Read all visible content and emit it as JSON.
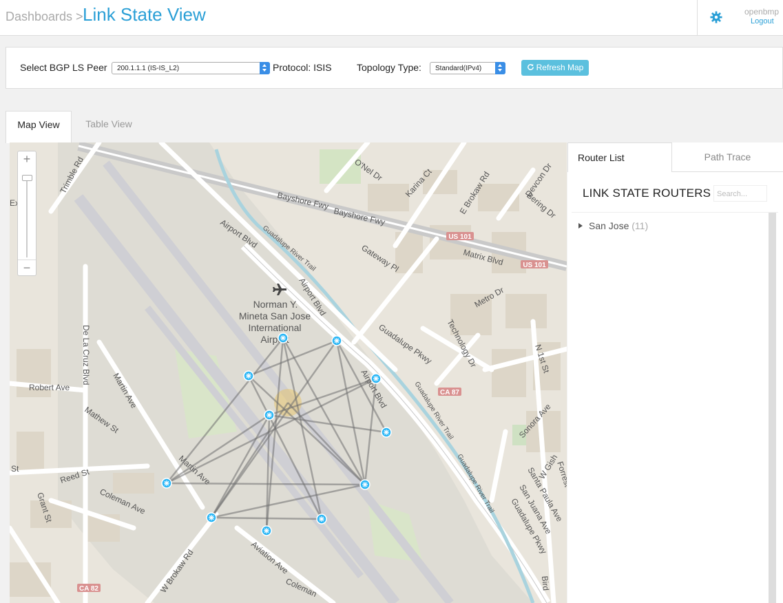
{
  "header": {
    "breadcrumb": "Dashboards >",
    "title": "Link State View",
    "username": "openbmp",
    "logout": "Logout"
  },
  "controls": {
    "peer_label": "Select BGP LS Peer",
    "peer_value": "200.1.1.1 (IS-IS_L2)",
    "protocol_label": "Protocol: ISIS",
    "topology_label": "Topology Type:",
    "topology_value": "Standard(IPv4)",
    "refresh_label": "Refresh Map"
  },
  "tabs": {
    "map": "Map View",
    "table": "Table View"
  },
  "map": {
    "zoom_in": "+",
    "zoom_out": "−",
    "airport_name": [
      "Norman Y.",
      "Mineta San Jose",
      "International",
      "Airport"
    ],
    "streets": [
      "Trimble Rd",
      "Bayshore Fwy",
      "Bayshore Fwy",
      "O'Nel Dr",
      "Karina Ct",
      "E Brokaw Rd",
      "Devcon Dr",
      "Bering Dr",
      "Airport Blvd",
      "Guadalupe River Trail",
      "Gateway Pl",
      "Matrix Blvd",
      "Airport Blvd",
      "Metro Dr",
      "Technology Dr",
      "Guadalupe Pkwy",
      "N 1st St",
      "De La Cruz Blvd",
      "Robert Ave",
      "Martin Ave",
      "Mathew St",
      "Airport Blvd",
      "Guadalupe River Trail",
      "Reed St",
      "Martin Ave",
      "Coleman Ave",
      "Grant St",
      "W Brokaw Rd",
      "Aviation Ave",
      "Coleman",
      "Sonora Ave",
      "W Gish",
      "Forrest",
      "Santa Paula Ave",
      "San Juana Ave",
      "Guadalupe Pkwy",
      "Guadalupe River Trail",
      "Bird",
      "St",
      "Ex"
    ],
    "shields": [
      "US 101",
      "US 101",
      "CA 87",
      "CA 82"
    ]
  },
  "sidebar": {
    "tab_router_list": "Router List",
    "tab_path_trace": "Path Trace",
    "heading": "LINK STATE ROUTERS",
    "search_placeholder": "Search...",
    "group_name": "San Jose",
    "group_count": "(11)"
  },
  "colors": {
    "accent": "#2a9fd6",
    "router_fill": "#29b6f6",
    "link": "#777777"
  }
}
